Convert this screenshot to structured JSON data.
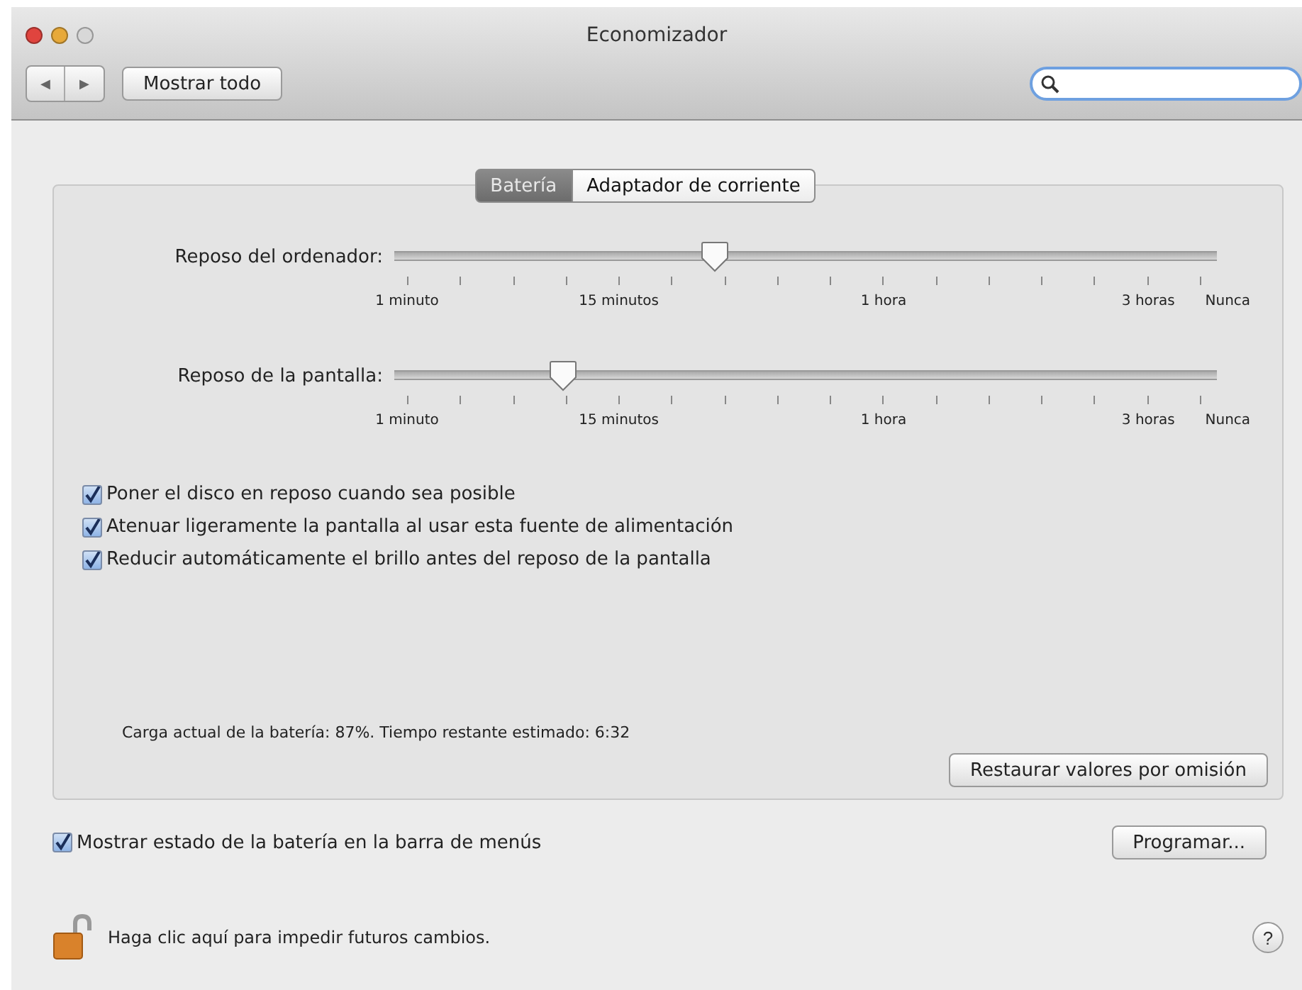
{
  "window": {
    "title": "Economizador"
  },
  "toolbar": {
    "back_label": "◀",
    "forward_label": "▶",
    "show_all": "Mostrar todo"
  },
  "tabs": [
    {
      "label": "Batería",
      "selected": true
    },
    {
      "label": "Adaptador de corriente",
      "selected": false
    }
  ],
  "sliders": [
    {
      "label": "Reposo del ordenador:",
      "level": 0.4,
      "ticks": [
        "1 minuto",
        "15 minutos",
        "1 hora",
        "3 horas",
        "Nunca"
      ]
    },
    {
      "label": "Reposo de la pantalla:",
      "level": 0.21,
      "ticks": [
        "1 minuto",
        "15 minutos",
        "1 hora",
        "3 horas",
        "Nunca"
      ]
    }
  ],
  "options": [
    {
      "label": "Poner el disco en reposo cuando sea posible",
      "checked": true
    },
    {
      "label": "Atenuar ligeramente la pantalla al usar esta fuente de alimentación",
      "checked": true
    },
    {
      "label": "Reducir automáticamente el brillo antes del reposo de la pantalla",
      "checked": true
    }
  ],
  "battery_status": "Carga actual de la batería: 87%. Tiempo restante estimado: 6:32",
  "restore_button": "Restaurar valores por omisión",
  "show_status": {
    "label": "Mostrar estado de la batería en la barra de menús",
    "checked": true
  },
  "schedule_button": "Programar...",
  "lock": {
    "label": "Haga clic aquí para impedir futuros cambios.",
    "locked": false
  },
  "help": "?"
}
